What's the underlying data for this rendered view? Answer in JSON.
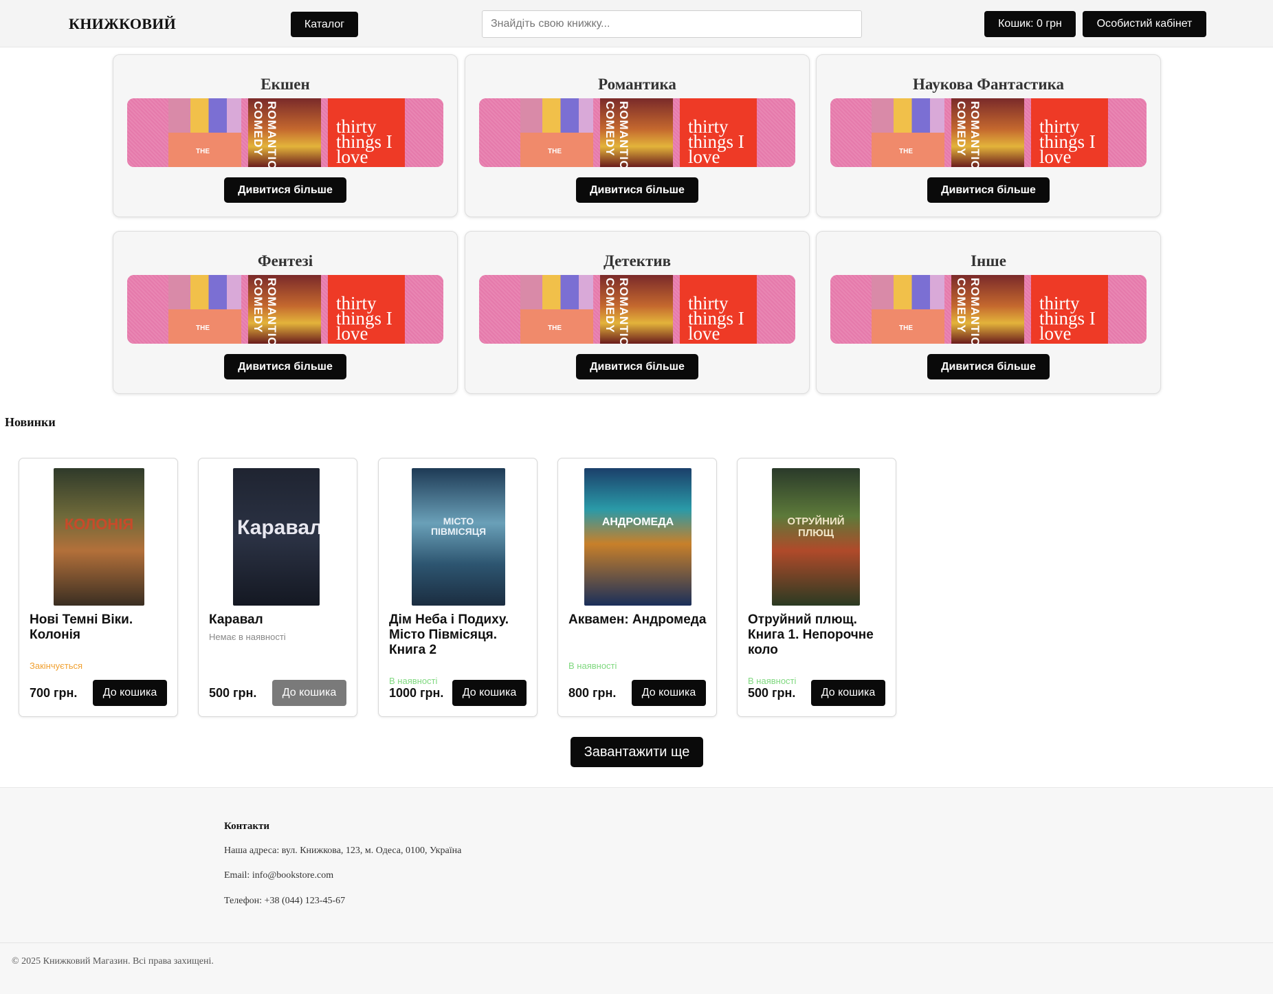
{
  "header": {
    "logo": "КНИЖКОВИЙ",
    "catalog_label": "Каталог",
    "search_placeholder": "Знайдіть свою книжку...",
    "cart_label": "Кошик: 0 грн",
    "account_label": "Особистий кабінет"
  },
  "genres": [
    {
      "title": "Екшен",
      "button": "Дивитися більше"
    },
    {
      "title": "Романтика",
      "button": "Дивитися більше"
    },
    {
      "title": "Наукова Фантастика",
      "button": "Дивитися більше"
    },
    {
      "title": "Фентезі",
      "button": "Дивитися більше"
    },
    {
      "title": "Детектив",
      "button": "Дивитися більше"
    },
    {
      "title": "Інше",
      "button": "Дивитися більше"
    }
  ],
  "banner": {
    "book2_text": "THE",
    "book3_text": "ROMANTIC COMEDY",
    "book4_text": "thirty things I love"
  },
  "new_arrivals": {
    "title": "Новинки",
    "products": [
      {
        "title": "Нові Темні Віки. Колонія",
        "status": "Закінчується",
        "status_color": "#f0a030",
        "price": "700 грн.",
        "button": "До кошика",
        "disabled": false,
        "cover_text": "КОЛОНІЯ"
      },
      {
        "title": "Каравал",
        "status": "Немає в наявності",
        "status_color": "#888888",
        "price": "500 грн.",
        "button": "До кошика",
        "disabled": true,
        "cover_text": "Каравал"
      },
      {
        "title": "Дім Неба і Подиху. Місто Півмісяця. Книга 2",
        "status": "В наявності",
        "status_color": "#7fd87f",
        "price": "1000 грн.",
        "button": "До кошика",
        "disabled": false,
        "cover_text": "МІСТО ПІВМІСЯЦЯ"
      },
      {
        "title": "Аквамен: Андромеда",
        "status": "В наявності",
        "status_color": "#7fd87f",
        "price": "800 грн.",
        "button": "До кошика",
        "disabled": false,
        "cover_text": "АНДРОМЕДА"
      },
      {
        "title": "Отруйний плющ. Книга 1. Непорочне коло",
        "status": "В наявності",
        "status_color": "#7fd87f",
        "price": "500 грн.",
        "button": "До кошика",
        "disabled": false,
        "cover_text": "ОТРУЙНИЙ ПЛЮЩ"
      }
    ],
    "load_more": "Завантажити ще"
  },
  "footer": {
    "title": "Контакти",
    "address": "Наша адреса: вул. Книжкова, 123, м. Одеса, 0100, Україна",
    "email": "Email: info@bookstore.com",
    "phone": "Телефон: +38 (044) 123-45-67",
    "copyright": "© 2025 Книжковий Магазин. Всі права захищені."
  }
}
